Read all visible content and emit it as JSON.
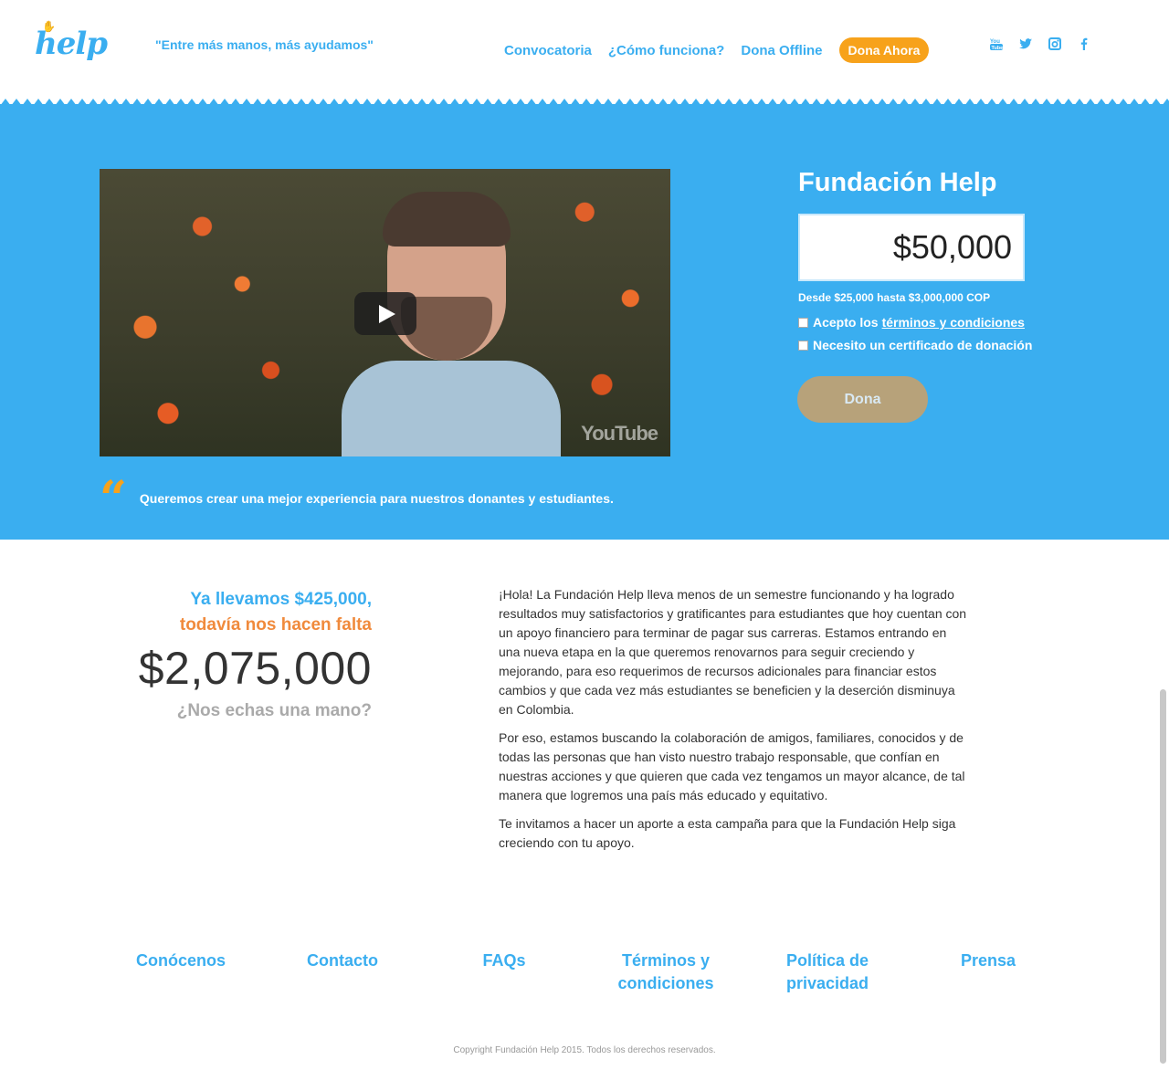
{
  "header": {
    "logo": "help",
    "tagline": "\"Entre más manos, más ayudamos\"",
    "nav": [
      "Convocatoria",
      "¿Cómo funciona?",
      "Dona Offline"
    ],
    "cta": "Dona Ahora",
    "social": [
      "youtube-icon",
      "twitter-icon",
      "instagram-icon",
      "facebook-icon"
    ]
  },
  "hero": {
    "quote": "Queremos crear una mejor experiencia para nuestros donantes y estudiantes.",
    "video_watermark": "YouTube",
    "donate": {
      "title": "Fundación Help",
      "amount": "$50,000",
      "range": "Desde $25,000 hasta $3,000,000 COP",
      "terms_prefix": "Acepto los",
      "terms_link": "términos y condiciones",
      "certificate": "Necesito un certificado de donación",
      "button": "Dona"
    }
  },
  "stats": {
    "line1": "Ya llevamos $425,000,",
    "line2": "todavía nos hacen falta",
    "remaining": "$2,075,000",
    "ask": "¿Nos echas una mano?"
  },
  "body": {
    "p1": "¡Hola! La Fundación Help lleva menos de un semestre funcionando y ha logrado resultados muy satisfactorios y gratificantes para estudiantes que hoy cuentan con un apoyo financiero para terminar de pagar sus carreras. Estamos entrando en una nueva etapa en la que queremos renovarnos para seguir creciendo y mejorando, para eso requerimos de recursos adicionales para financiar estos cambios y que cada vez más estudiantes se beneficien y la deserción disminuya en Colombia.",
    "p2": "Por eso, estamos buscando la colaboración de amigos, familiares, conocidos y de todas las personas que han visto nuestro trabajo responsable, que confían en nuestras acciones y que quieren que cada vez tengamos un mayor alcance, de tal manera que logremos una país más educado y equitativo.",
    "p3": "Te invitamos a hacer un aporte a esta campaña para que la Fundación Help siga creciendo con tu apoyo."
  },
  "footer": {
    "links": [
      "Conócenos",
      "Contacto",
      "FAQs",
      "Términos y condiciones",
      "Política de privacidad",
      "Prensa"
    ],
    "copyright": "Copyright Fundación Help 2015. Todos los derechos reservados."
  },
  "colors": {
    "brand_blue": "#3aaef0",
    "accent_orange": "#f7a21b",
    "button_tan": "#b7a27a"
  }
}
